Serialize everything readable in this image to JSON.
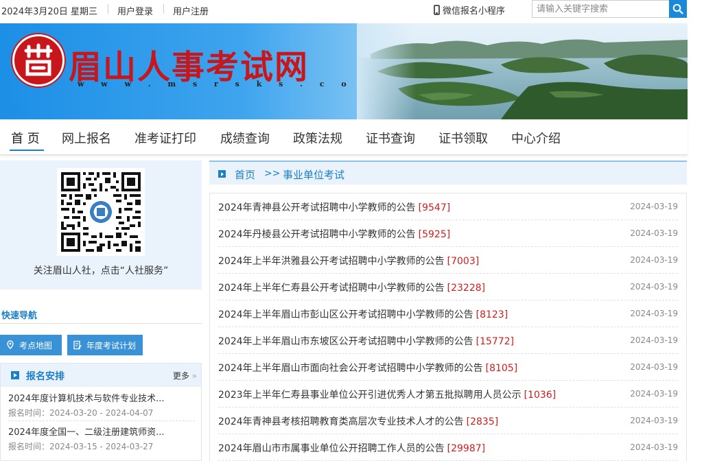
{
  "topbar": {
    "date": "2024年3月20日 星期三",
    "login": "用户登录",
    "register": "用户注册",
    "wechat": "微信报名小程序",
    "search_placeholder": "请输入关键字搜索",
    "icons": [
      "phone-icon",
      "search-icon"
    ]
  },
  "banner": {
    "title": "眉山人事考试网",
    "url": "w w w . m s r s k s . c o m . c n",
    "brand_color": "#c8161d"
  },
  "nav": {
    "items": [
      "首 页",
      "网上报名",
      "准考证打印",
      "成绩查询",
      "政策法规",
      "证书查询",
      "证书领取",
      "中心介绍"
    ],
    "active_index": 0
  },
  "sidebar": {
    "qr_caption": "关注眉山人社，点击“人社服务”",
    "quick_nav_title": "快速导航",
    "quick_buttons": [
      {
        "label": "考点地图",
        "icon": "map-pin-icon"
      },
      {
        "label": "年度考试计划",
        "icon": "document-edit-icon"
      }
    ],
    "arrangement": {
      "title": "报名安排",
      "more": "更多",
      "items": [
        {
          "title": "2024年度计算机技术与软件专业技术...",
          "time": "报名时间：2024-03-20 - 2024-04-07"
        },
        {
          "title": "2024年度全国一、二级注册建筑师资...",
          "time": "报名时间：2024-03-15 - 2024-03-27"
        }
      ]
    }
  },
  "breadcrumb": {
    "home": "首页",
    "separator": ">>",
    "current": "事业单位考试"
  },
  "list": [
    {
      "title": "2024年青神县公开考试招聘中小学教师的公告",
      "count": "[9547]",
      "date": "2024-03-19"
    },
    {
      "title": "2024年丹棱县公开考试招聘中小学教师的公告",
      "count": "[5925]",
      "date": "2024-03-19"
    },
    {
      "title": "2024年上半年洪雅县公开考试招聘中小学教师的公告",
      "count": "[7003]",
      "date": "2024-03-19"
    },
    {
      "title": "2024年上半年仁寿县公开考试招聘中小学教师的公告",
      "count": "[23228]",
      "date": "2024-03-19"
    },
    {
      "title": "2024年上半年眉山市彭山区公开考试招聘中小学教师的公告",
      "count": "[8123]",
      "date": "2024-03-19"
    },
    {
      "title": "2024年上半年眉山市东坡区公开考试招聘中小学教师的公告",
      "count": "[15772]",
      "date": "2024-03-19"
    },
    {
      "title": "2024年上半年眉山市面向社会公开考试招聘中小学教师的公告",
      "count": "[8105]",
      "date": "2024-03-19"
    },
    {
      "title": "2023年上半年仁寿县事业单位公开引进优秀人才第五批拟聘用人员公示",
      "count": "[1036]",
      "date": "2024-03-19"
    },
    {
      "title": "2024年青神县考核招聘教育类高层次专业技术人才的公告",
      "count": "[2835]",
      "date": "2024-03-19"
    },
    {
      "title": "2024年眉山市市属事业单位公开招聘工作人员的公告",
      "count": "[29987]",
      "date": "2024-03-19"
    }
  ],
  "colors": {
    "accent": "#1a7ec9",
    "count": "#d31c1c",
    "panel_bg": "#eaf3fb"
  }
}
